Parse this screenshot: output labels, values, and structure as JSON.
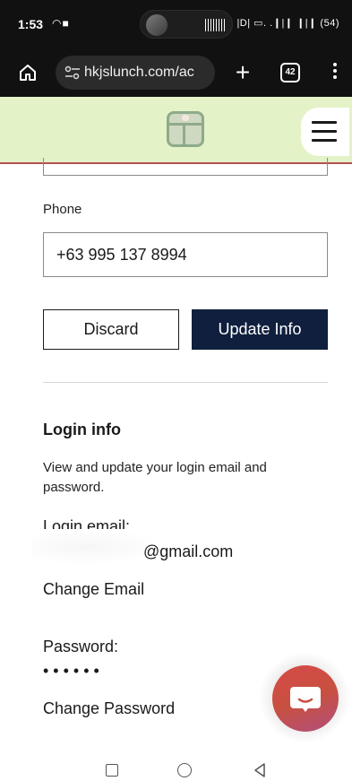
{
  "status_bar": {
    "time": "1:53",
    "left_icons": "◠■",
    "right_icons": "|D| ▭. .❙|❙ ❙|❙ (54)"
  },
  "browser": {
    "url": "hkjslunch.com/ac",
    "new_tab_glyph": "+",
    "tab_count": "42"
  },
  "form": {
    "phone_label": "Phone",
    "phone_value": "+63 995 137 8994",
    "discard_label": "Discard",
    "update_label": "Update Info"
  },
  "login": {
    "title": "Login info",
    "description": "View and update your login email and password.",
    "email_label": "Login email:",
    "email_value": "@gmail.com",
    "change_email": "Change Email",
    "password_label": "Password:",
    "password_mask": "••••••",
    "change_password": "Change Password"
  },
  "colors": {
    "header_bg": "#e4f2c8",
    "primary_button": "#0f1f3d",
    "header_border": "#b35050",
    "chat_fab": "#d74a49"
  },
  "icons": {
    "home": "home-icon",
    "site_settings": "tune-icon",
    "new_tab": "plus-icon",
    "tabs": "tab-switcher-icon",
    "menu": "more-vert-icon",
    "logo": "lunchbox-gift-icon",
    "hamburger": "hamburger-icon",
    "chat": "chat-bubble-icon",
    "nav_recents": "recents-icon",
    "nav_home": "circle-home-icon",
    "nav_back": "back-triangle-icon"
  }
}
